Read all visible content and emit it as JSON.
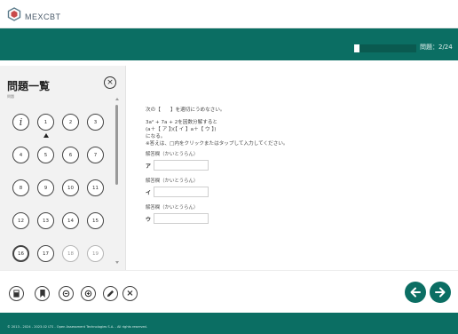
{
  "header": {
    "logo_text": "MEXCBT",
    "logo_sub": ""
  },
  "progress": {
    "fraction": 0.083,
    "counter_text": "問題：2/24"
  },
  "sidebar": {
    "title": "問題一覧",
    "subtitle": "問題",
    "close_icon": "close-icon",
    "questions": [
      {
        "label": "i",
        "kind": "info"
      },
      {
        "label": "1",
        "kind": "current"
      },
      {
        "label": "2",
        "kind": "normal"
      },
      {
        "label": "3",
        "kind": "normal"
      },
      {
        "label": "4",
        "kind": "normal"
      },
      {
        "label": "5",
        "kind": "normal"
      },
      {
        "label": "6",
        "kind": "normal"
      },
      {
        "label": "7",
        "kind": "normal"
      },
      {
        "label": "8",
        "kind": "normal"
      },
      {
        "label": "9",
        "kind": "normal"
      },
      {
        "label": "10",
        "kind": "normal"
      },
      {
        "label": "11",
        "kind": "normal"
      },
      {
        "label": "12",
        "kind": "normal"
      },
      {
        "label": "13",
        "kind": "normal"
      },
      {
        "label": "14",
        "kind": "normal"
      },
      {
        "label": "15",
        "kind": "normal"
      },
      {
        "label": "16",
        "kind": "bold"
      },
      {
        "label": "17",
        "kind": "normal"
      },
      {
        "label": "18",
        "kind": "dim"
      },
      {
        "label": "19",
        "kind": "dim"
      }
    ]
  },
  "question": {
    "instruction": "次の【　　】を適切にうめなさい。",
    "expression": "3a² + 7a + 2を因数分解すると",
    "factored": "(a＋【 ア 】)(【 イ 】a＋【 ウ 】)",
    "naru": "になる。",
    "note": "※答えは、□内をクリックまたはタップして入力してください。",
    "answers": [
      {
        "label": "解答欄（かいとうらん）",
        "kana": "ア",
        "value": ""
      },
      {
        "label": "解答欄（かいとうらん）",
        "kana": "イ",
        "value": ""
      },
      {
        "label": "解答欄（かいとうらん）",
        "kana": "ウ",
        "value": ""
      }
    ]
  },
  "toolbar": {
    "tools": [
      "calculator-icon",
      "bookmark-icon",
      "zoom-out-icon",
      "zoom-in-icon",
      "pen-icon",
      "close-icon"
    ],
    "close_glyph": "×"
  },
  "navigation": {
    "prev_icon": "arrow-left-icon",
    "next_icon": "arrow-right-icon"
  },
  "footer": {
    "text": "© 2013 - 2024 - 2023.02 LTS - Open Assessment Technologies S.A. - All rights reserved."
  },
  "colors": {
    "brand": "#0b6e63",
    "accent_dark": "#0a5a50"
  }
}
